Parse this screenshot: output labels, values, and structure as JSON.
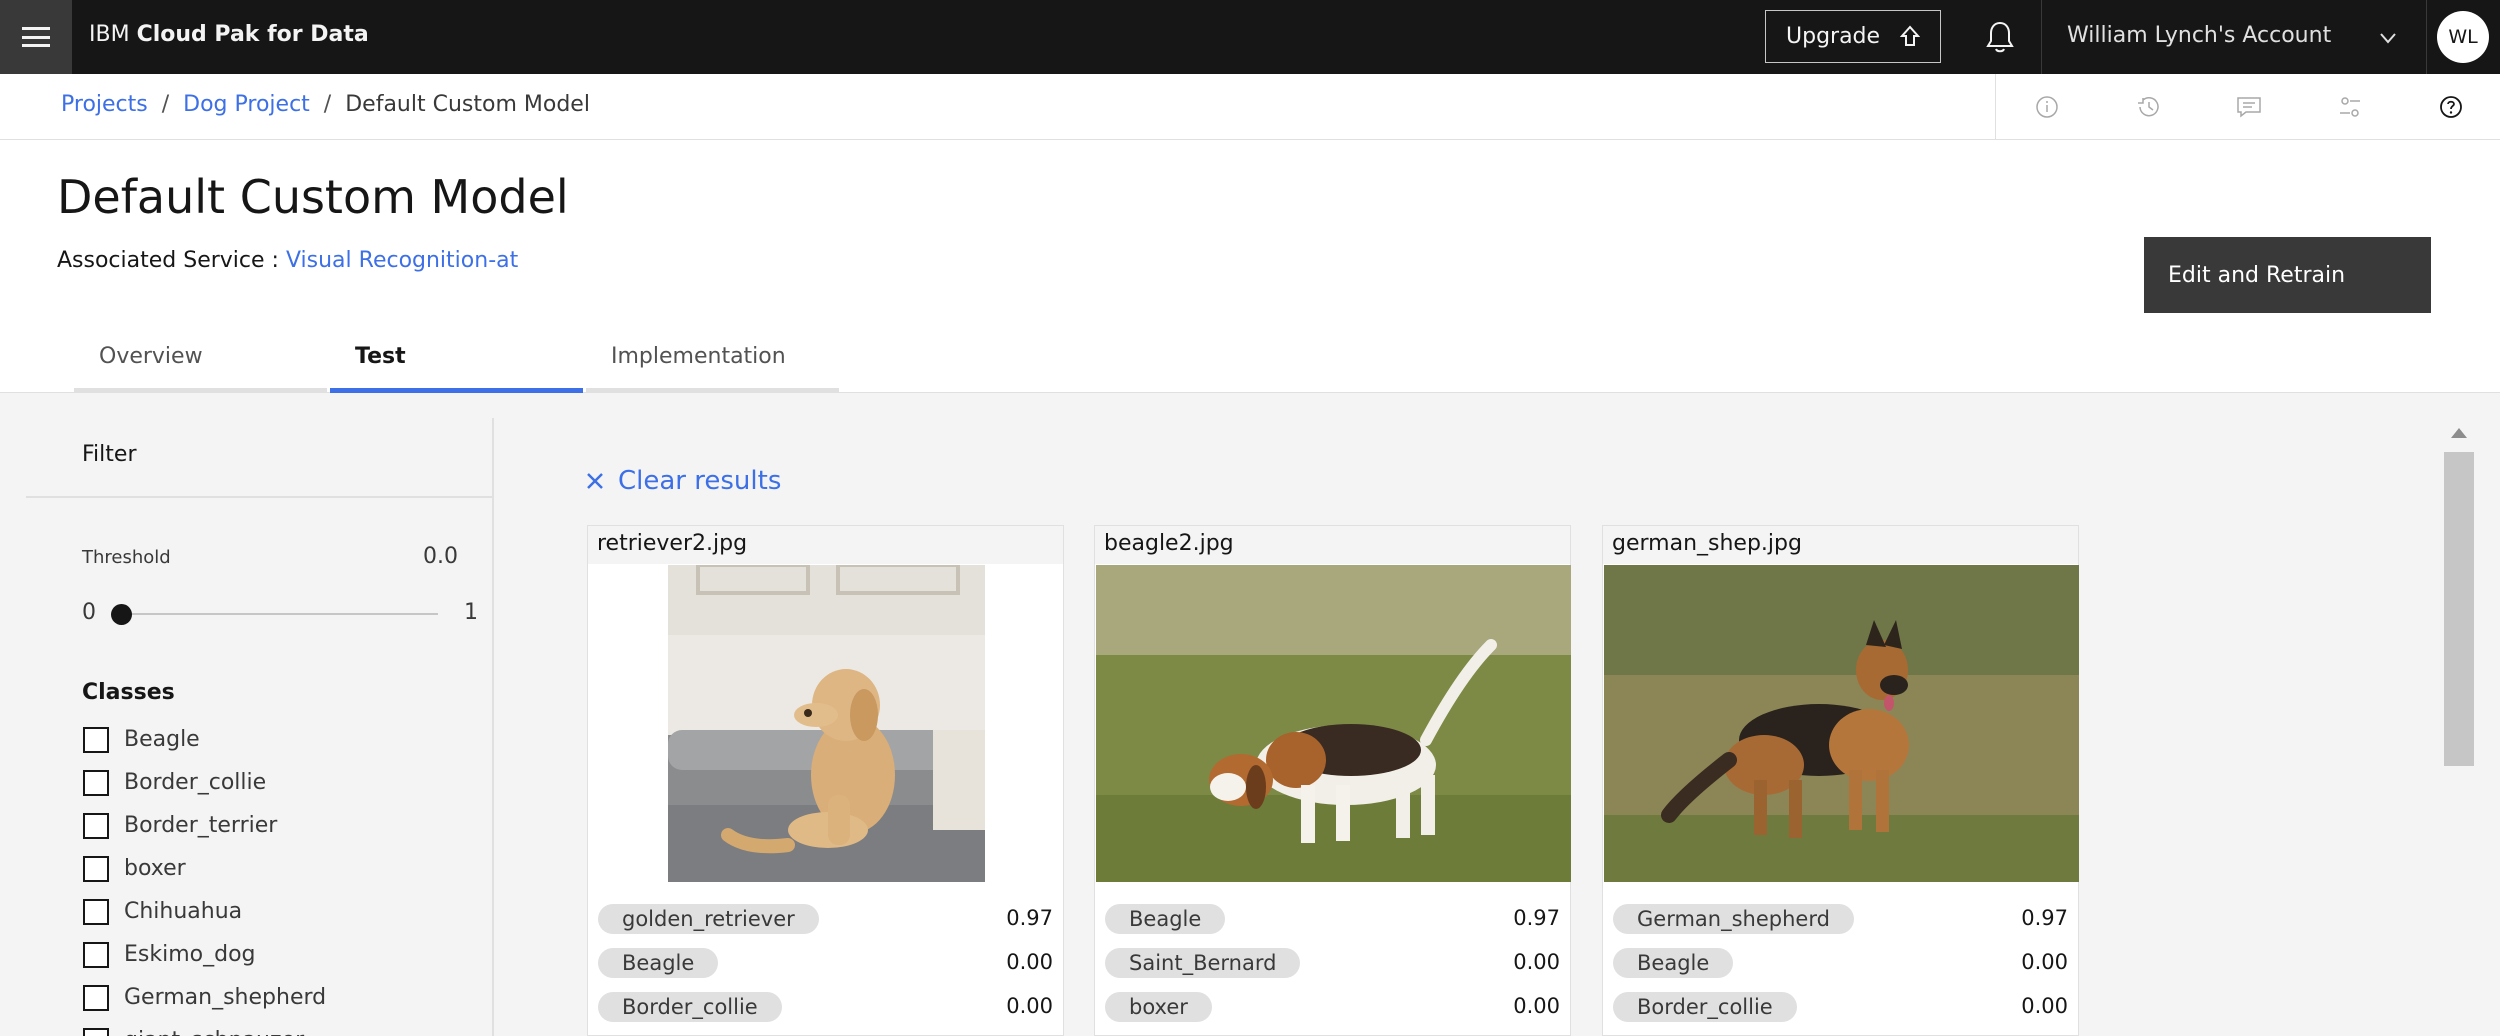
{
  "topbar": {
    "brand_prefix": "IBM",
    "brand_name": "Cloud Pak for Data",
    "upgrade_label": "Upgrade",
    "account_label": "William Lynch's Account",
    "avatar_initials": "WL"
  },
  "breadcrumb": {
    "items": [
      "Projects",
      "Dog Project",
      "Default Custom Model"
    ],
    "separator": "/"
  },
  "header": {
    "title": "Default Custom Model",
    "assoc_label": "Associated Service :",
    "assoc_link": "Visual Recognition-at",
    "retrain_label": "Edit and Retrain"
  },
  "tabs": [
    {
      "label": "Overview",
      "active": false
    },
    {
      "label": "Test",
      "active": true
    },
    {
      "label": "Implementation",
      "active": false
    }
  ],
  "filter": {
    "title": "Filter",
    "threshold_label": "Threshold",
    "threshold_value": "0.0",
    "slider_min": "0",
    "slider_max": "1",
    "classes_title": "Classes",
    "classes": [
      "Beagle",
      "Border_collie",
      "Border_terrier",
      "boxer",
      "Chihuahua",
      "Eskimo_dog",
      "German_shepherd",
      "giant_schnauzer"
    ]
  },
  "results": {
    "clear_label": "Clear results",
    "cards": [
      {
        "filename": "retriever2.jpg",
        "scores": [
          {
            "label": "golden_retriever",
            "value": "0.97"
          },
          {
            "label": "Beagle",
            "value": "0.00"
          },
          {
            "label": "Border_collie",
            "value": "0.00"
          }
        ]
      },
      {
        "filename": "beagle2.jpg",
        "scores": [
          {
            "label": "Beagle",
            "value": "0.97"
          },
          {
            "label": "Saint_Bernard",
            "value": "0.00"
          },
          {
            "label": "boxer",
            "value": "0.00"
          }
        ]
      },
      {
        "filename": "german_shep.jpg",
        "scores": [
          {
            "label": "German_shepherd",
            "value": "0.97"
          },
          {
            "label": "Beagle",
            "value": "0.00"
          },
          {
            "label": "Border_collie",
            "value": "0.00"
          }
        ]
      }
    ]
  },
  "colors": {
    "accent": "#3d70e6",
    "topbar": "#161616",
    "button_dark": "#393939"
  }
}
